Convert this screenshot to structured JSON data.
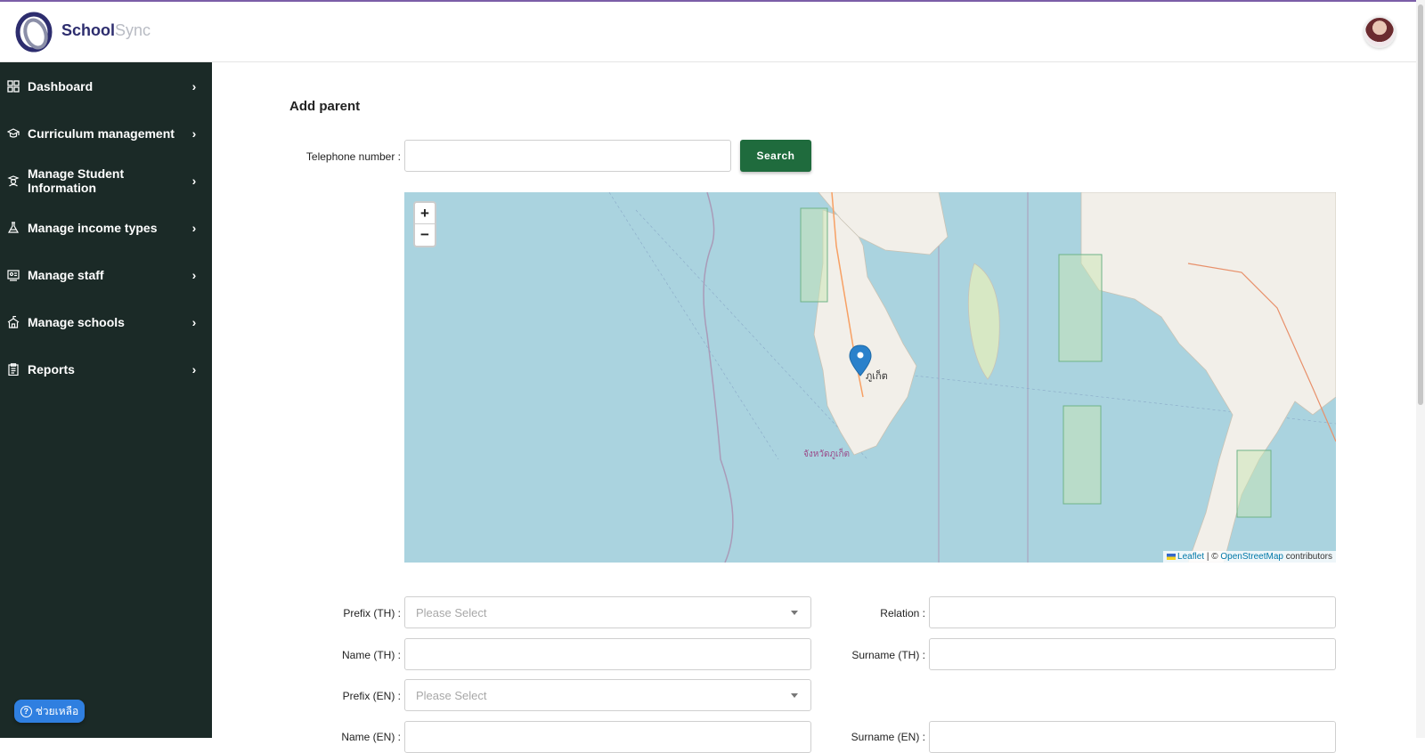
{
  "app": {
    "brand_part1": "School",
    "brand_part2": "Sync"
  },
  "sidebar": {
    "items": [
      {
        "label": "Dashboard",
        "icon": "grid-icon"
      },
      {
        "label": "Curriculum management",
        "icon": "graduation-cap-icon"
      },
      {
        "label": "Manage Student Information",
        "icon": "student-icon"
      },
      {
        "label": "Manage income types",
        "icon": "flask-icon"
      },
      {
        "label": "Manage staff",
        "icon": "staff-board-icon"
      },
      {
        "label": "Manage schools",
        "icon": "school-icon"
      },
      {
        "label": "Reports",
        "icon": "clipboard-icon"
      }
    ],
    "chevron": "›"
  },
  "help": {
    "label": "ช่วยเหลือ"
  },
  "page": {
    "title": "Add parent"
  },
  "form": {
    "telephone_label": "Telephone number :",
    "telephone_value": "",
    "search_label": "Search",
    "prefix_th_label": "Prefix (TH) :",
    "prefix_th_value": "Please Select",
    "relation_label": "Relation :",
    "relation_value": "",
    "name_th_label": "Name (TH) :",
    "name_th_value": "",
    "surname_th_label": "Surname (TH) :",
    "surname_th_value": "",
    "prefix_en_label": "Prefix (EN) :",
    "prefix_en_value": "Please Select",
    "name_en_label": "Name (EN) :",
    "surname_en_label": "Surname (EN) :"
  },
  "map": {
    "zoom_in": "+",
    "zoom_out": "−",
    "attribution_leaflet": "Leaflet",
    "attribution_sep": " | © ",
    "attribution_osm": "OpenStreetMap",
    "attribution_tail": " contributors",
    "place_label": "จังหวัดภูเก็ต",
    "city_label": "ภูเก็ต",
    "colors": {
      "water": "#aad3df",
      "land": "#f2efe9",
      "park": "#c8e6b4"
    }
  }
}
